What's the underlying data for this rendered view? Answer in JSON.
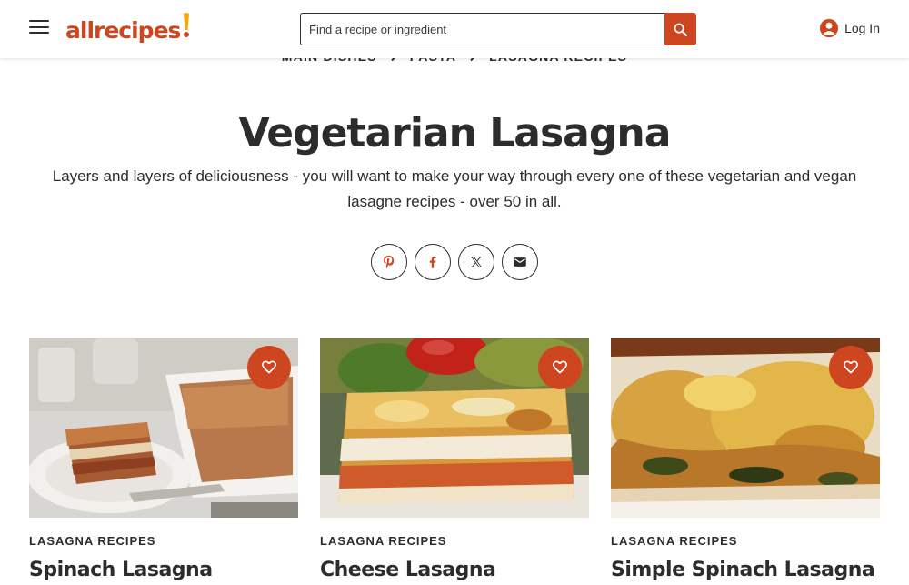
{
  "header": {
    "logo_text": "allrecipes",
    "search_placeholder": "Find a recipe or ingredient",
    "login_label": "Log In"
  },
  "breadcrumb": [
    "MAIN DISHES",
    "PASTA",
    "LASAGNA RECIPES"
  ],
  "page": {
    "title": "Vegetarian Lasagna",
    "subtitle": "Layers and layers of deliciousness - you will want to make your way through every one of these vegetarian and vegan lasagne recipes - over 50 in all."
  },
  "share": [
    "pinterest-icon",
    "facebook-icon",
    "x-icon",
    "email-icon"
  ],
  "cards": [
    {
      "tag": "LASAGNA RECIPES",
      "title": "Spinach Lasagna"
    },
    {
      "tag": "LASAGNA RECIPES",
      "title": "Cheese Lasagna"
    },
    {
      "tag": "LASAGNA RECIPES",
      "title": "Simple Spinach Lasagna"
    }
  ],
  "colors": {
    "brand": "#ce4620",
    "text": "#2c2c2c"
  }
}
